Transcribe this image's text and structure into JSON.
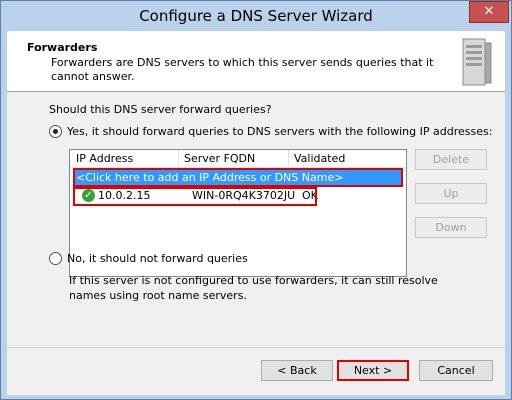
{
  "window": {
    "title": "Configure a DNS Server Wizard",
    "close_glyph": "✕"
  },
  "header": {
    "title": "Forwarders",
    "description": "Forwarders are DNS servers to which this server sends queries that it cannot answer."
  },
  "question": "Should this DNS server forward queries?",
  "options": {
    "yes_label": "Yes, it should forward queries to DNS servers with the following IP addresses:",
    "no_label": "No, it should not forward queries",
    "selected": "yes"
  },
  "table": {
    "columns": [
      "IP Address",
      "Server FQDN",
      "Validated"
    ],
    "add_placeholder": "<Click here to add an IP Address or DNS Name>",
    "rows": [
      {
        "ip": "10.0.2.15",
        "fqdn": "WIN-0RQ4K3702JU",
        "validated": "OK",
        "status_icon": "check-circle-icon"
      }
    ]
  },
  "side_buttons": {
    "delete": "Delete",
    "up": "Up",
    "down": "Down"
  },
  "info": "If this server is not configured to use forwarders, it can still resolve names using root name servers.",
  "footer": {
    "back": "< Back",
    "next": "Next >",
    "cancel": "Cancel"
  },
  "colors": {
    "selection": "#3399ff",
    "highlight": "#e00000",
    "title_bar": "#b9d1ea"
  }
}
